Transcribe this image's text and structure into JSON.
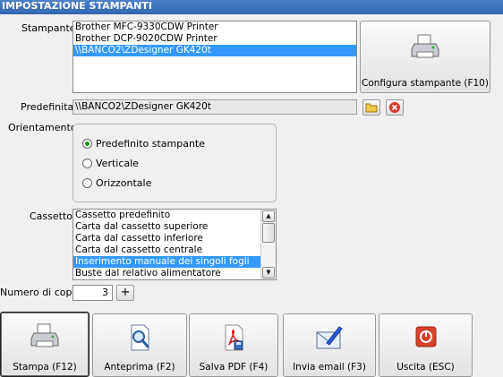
{
  "window": {
    "title": "IMPOSTAZIONE STAMPANTI"
  },
  "printer": {
    "label": "Stampante",
    "items": [
      {
        "label": "Brother MFC-9330CDW Printer",
        "selected": false
      },
      {
        "label": "Brother DCP-9020CDW Printer",
        "selected": false
      },
      {
        "label": "\\\\BANCO2\\ZDesigner GK420t",
        "selected": true
      }
    ],
    "configure_label": "Configura stampante (F10)",
    "configure_icon": "printer-icon"
  },
  "default_printer": {
    "label": "Predefinita",
    "value": "\\\\BANCO2\\ZDesigner GK420t",
    "open_icon": "folder-icon",
    "clear_icon": "delete-icon"
  },
  "orientation": {
    "label": "Orientamento",
    "options": [
      {
        "label": "Predefinito stampante",
        "selected": true
      },
      {
        "label": "Verticale",
        "selected": false
      },
      {
        "label": "Orizzontale",
        "selected": false
      }
    ]
  },
  "tray": {
    "label": "Cassetto",
    "items": [
      {
        "label": "Cassetto predefinito",
        "selected": false
      },
      {
        "label": "Carta dal cassetto superiore",
        "selected": false
      },
      {
        "label": "Carta dal cassetto inferiore",
        "selected": false
      },
      {
        "label": "Carta dal cassetto centrale",
        "selected": false
      },
      {
        "label": "Inserimento manuale dei singoli fogli",
        "selected": true
      },
      {
        "label": "Buste dal relativo alimentatore",
        "selected": false
      }
    ],
    "scroll_position": 0.3
  },
  "copies": {
    "label": "Numero di copie",
    "value": "3",
    "increment_label": "+"
  },
  "actions": [
    {
      "label": "Stampa (F12)",
      "icon": "printer-icon",
      "focused": true
    },
    {
      "label": "Anteprima (F2)",
      "icon": "preview-icon",
      "focused": false
    },
    {
      "label": "Salva PDF (F4)",
      "icon": "pdf-icon",
      "focused": false
    },
    {
      "label": "Invia email (F3)",
      "icon": "email-icon",
      "focused": false
    },
    {
      "label": "Uscita (ESC)",
      "icon": "exit-icon",
      "focused": false
    }
  ],
  "colors": {
    "selection": "#3399ff",
    "titlebar": "#2f66b0",
    "radio_dot": "#1c9a1c",
    "exit": "#d9412b"
  }
}
